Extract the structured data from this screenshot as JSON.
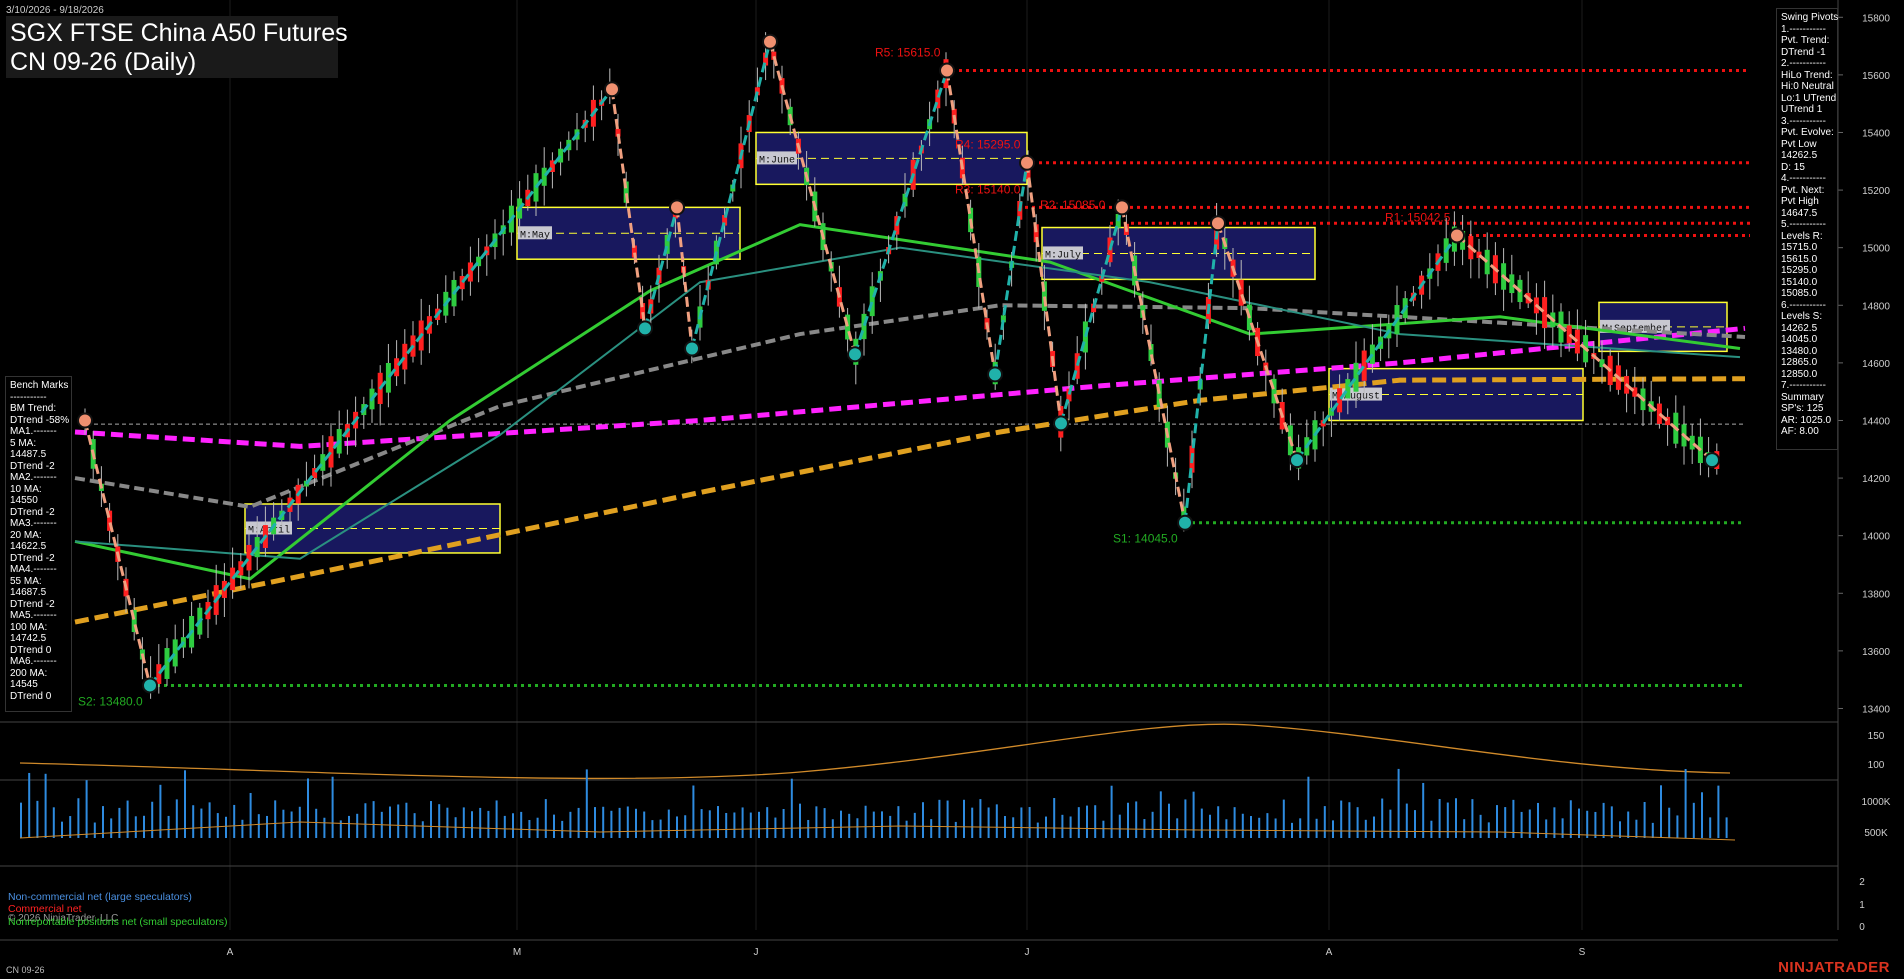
{
  "header": {
    "date_range": "3/10/2026 - 9/18/2026",
    "title_line1": "SGX FTSE China A50 Futures",
    "title_line2": "CN 09-26 (Daily)"
  },
  "swing_pivots_panel": [
    "Swing Pivots",
    "1.-----------",
    "Pvt. Trend:",
    "DTrend -1",
    "2.-----------",
    "HiLo Trend:",
    "Hi:0 Neutral",
    "Lo:1 UTrend",
    "UTrend 1",
    "3.-----------",
    "Pvt. Evolve:",
    "Pvt Low",
    "14262.5",
    "D: 15",
    "4.-----------",
    "Pvt. Next:",
    "Pvt High",
    "14647.5",
    "5.-----------",
    "Levels R:",
    "15715.0",
    "15615.0",
    "15295.0",
    "15140.0",
    "15085.0",
    "6.-----------",
    "Levels S:",
    "14262.5",
    "14045.0",
    "13480.0",
    "12865.0",
    "12850.0",
    "7.-----------",
    "Summary",
    "SP's: 125",
    "AR: 1025.0",
    "AF: 8.00"
  ],
  "benchmarks_panel": [
    "Bench Marks",
    "-----------",
    "BM Trend:",
    "DTrend -58%",
    "MA1.-------",
    "5 MA:",
    "14487.5",
    "DTrend -2",
    "MA2.-------",
    "10 MA:",
    "14550",
    "DTrend -2",
    "MA3.-------",
    "20 MA:",
    "14622.5",
    "DTrend -2",
    "MA4.-------",
    "55 MA:",
    "14687.5",
    "DTrend -2",
    "MA5.-------",
    "100 MA:",
    "14742.5",
    "DTrend 0",
    "MA6.-------",
    "200 MA:",
    "14545",
    "DTrend 0"
  ],
  "bottom_legend": {
    "noncommercial": "Non-commercial net (large speculators)",
    "commercial": "Commercial net",
    "nonreportable": "Nonreportable positions net (small speculators)",
    "copyright": "© 2026 NinjaTrader, LLC"
  },
  "footer": {
    "instrument": "CN 09-26",
    "brand": "NINJATRADER"
  },
  "colors": {
    "background": "#000000",
    "bull_candle": "#2ecc40",
    "bear_candle": "#ff2020",
    "swing_up": "#20b2aa",
    "swing_down": "#f0a080",
    "resistance": "#ee1111",
    "support": "#22aa22",
    "ma_magenta": "#ff22ff",
    "ma_orange": "#e0a020",
    "ma_gray": "#888888",
    "ma_green": "#33cc33",
    "zone_fill": "#1c1c6e",
    "zone_border": "#ffff33",
    "volume": "#2e8be0",
    "noncommercial": "#4a90e2",
    "commercial": "#ff2222",
    "nonreportable": "#33cc33"
  },
  "chart_data": {
    "type": "candlestick",
    "price_axis": {
      "ylim": [
        13360,
        15860
      ],
      "ticks": [
        13400,
        13600,
        13800,
        14000,
        14200,
        14400,
        14600,
        14800,
        15000,
        15200,
        15400,
        15600,
        15800
      ]
    },
    "x_tick_labels": [
      "A",
      "M",
      "J",
      "J",
      "A",
      "S"
    ],
    "resistance_levels": [
      {
        "label": "R5: 15615.0",
        "value": 15615
      },
      {
        "label": "R4: 15295.0",
        "value": 15295
      },
      {
        "label": "R3: 15140.0",
        "value": 15140
      },
      {
        "label": "R2: 15085.0",
        "value": 15085
      },
      {
        "label": "R1: 15042.5",
        "value": 15042.5
      }
    ],
    "support_levels": [
      {
        "label": "S1: 14045.0",
        "value": 14045
      },
      {
        "label": "S2: 13480.0",
        "value": 13480
      }
    ],
    "last_price": 14387.5,
    "monthly_zones": [
      {
        "label": "M:April",
        "high": 14110,
        "low": 13940
      },
      {
        "label": "M:May",
        "high": 15140,
        "low": 14960
      },
      {
        "label": "M:June",
        "high": 15400,
        "low": 15220
      },
      {
        "label": "M:July",
        "high": 15070,
        "low": 14890
      },
      {
        "label": "M:August",
        "high": 14580,
        "low": 14400
      },
      {
        "label": "M:September",
        "high": 14810,
        "low": 14640
      }
    ],
    "swing_pivots": [
      {
        "type": "high",
        "price": 14400
      },
      {
        "type": "low",
        "price": 13480
      },
      {
        "type": "high",
        "price": 15550
      },
      {
        "type": "low",
        "price": 14720
      },
      {
        "type": "high",
        "price": 15140
      },
      {
        "type": "low",
        "price": 14650
      },
      {
        "type": "high",
        "price": 15715
      },
      {
        "type": "low",
        "price": 14630
      },
      {
        "type": "high",
        "price": 15615
      },
      {
        "type": "low",
        "price": 14560
      },
      {
        "type": "high",
        "price": 15295
      },
      {
        "type": "low",
        "price": 14390
      },
      {
        "type": "high",
        "price": 15140
      },
      {
        "type": "low",
        "price": 14045
      },
      {
        "type": "high",
        "price": 15085
      },
      {
        "type": "low",
        "price": 14262.5
      },
      {
        "type": "high",
        "price": 15042.5
      },
      {
        "type": "low",
        "price": 14262.5
      }
    ],
    "moving_averages": [
      {
        "name": "200 MA",
        "start": 13700,
        "end": 14545
      },
      {
        "name": "100 MA",
        "start": 14360,
        "end": 14742.5
      },
      {
        "name": "55 MA",
        "start": 14200,
        "end": 14687.5
      },
      {
        "name": "20 MA",
        "start": 13980,
        "end": 14622.5
      }
    ],
    "lower_panels": {
      "indicator_ticks": [
        100,
        150
      ],
      "volume_ticks": [
        "500K",
        "1000K"
      ],
      "cot_ticks": [
        0,
        1,
        2
      ]
    }
  }
}
